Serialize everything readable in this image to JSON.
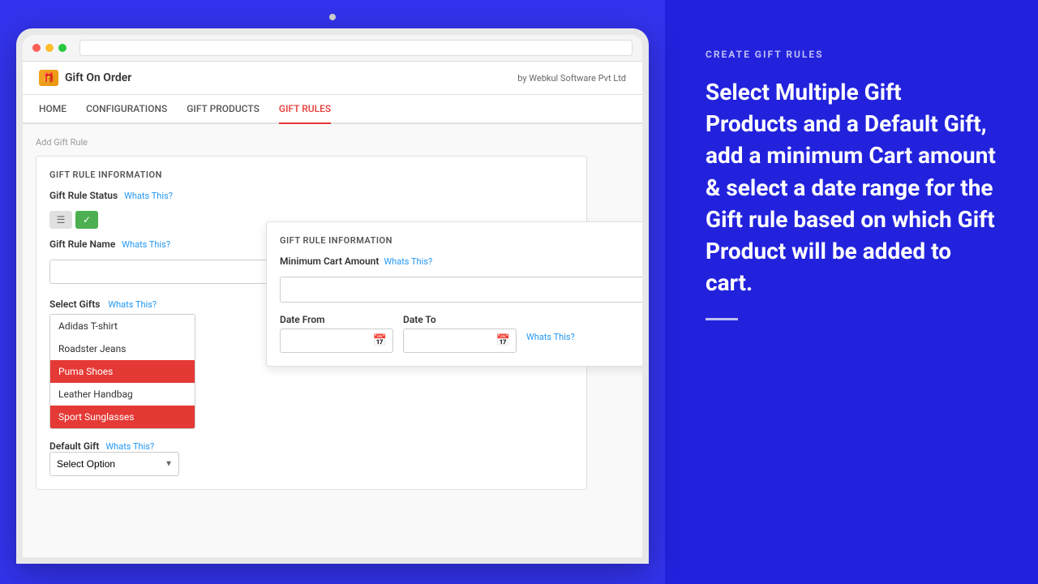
{
  "header": {
    "logo_icon": "🎁",
    "app_name": "Gift On Order",
    "tagline": "by Webkul Software Pvt Ltd"
  },
  "nav": {
    "items": [
      {
        "label": "HOME",
        "active": false
      },
      {
        "label": "CONFIGURATIONS",
        "active": false
      },
      {
        "label": "GIFT PRODUCTS",
        "active": false
      },
      {
        "label": "GIFT RULES",
        "active": true
      }
    ]
  },
  "breadcrumb": "Add Gift Rule",
  "form": {
    "section_title": "GIFT RULE INFORMATION",
    "gift_rule_status_label": "Gift Rule Status",
    "whats_this": "Whats This?",
    "gift_rule_name_label": "Gift Rule Name",
    "select_gifts_label": "Select Gifts",
    "select_gifts_whats_this": "Whats This?",
    "gift_options": [
      {
        "label": "Adidas T-shirt",
        "selected": false
      },
      {
        "label": "Roadster Jeans",
        "selected": false
      },
      {
        "label": "Puma Shoes",
        "selected": true
      },
      {
        "label": "Leather Handbag",
        "selected": false
      },
      {
        "label": "Sport Sunglasses",
        "selected": true
      }
    ],
    "default_gift_label": "Default Gift",
    "default_gift_whats_this": "Whats This?",
    "select_option_placeholder": "Select Option"
  },
  "second_card": {
    "section_title": "GIFT RULE INFORMATION",
    "min_cart_label": "Minimum Cart Amount",
    "min_cart_whats_this": "Whats This?",
    "date_from_label": "Date From",
    "date_to_label": "Date To",
    "date_whats_this": "Whats This?"
  },
  "right_panel": {
    "heading_label": "CREATE GIFT RULES",
    "description": "Select Multiple Gift Products and a Default Gift, add a minimum Cart amount & select a date range for the Gift rule based on which Gift Product will be added to cart."
  }
}
